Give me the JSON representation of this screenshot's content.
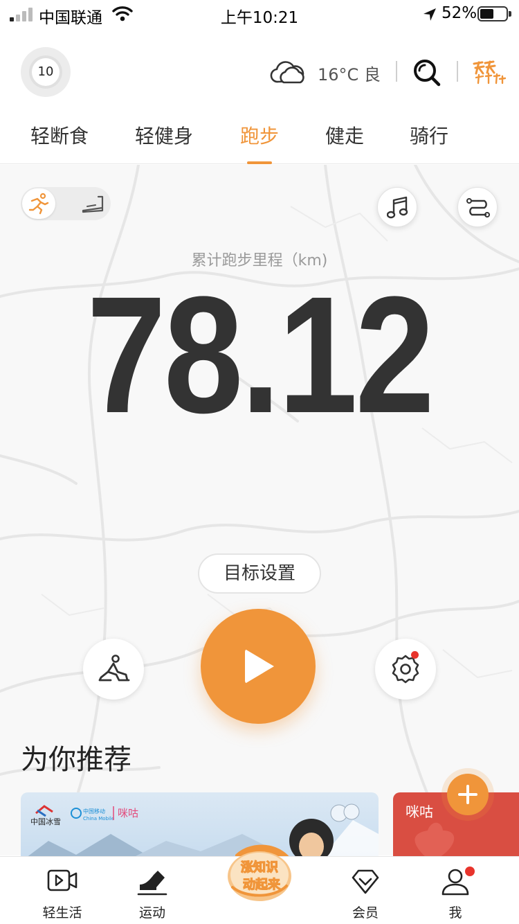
{
  "status_bar": {
    "carrier": "中国联通",
    "time": "上午10:21",
    "battery": "52%",
    "battery_level": 0.52
  },
  "header": {
    "level": "10",
    "weather": "16°C 良",
    "weather_icon": "cloud-icon",
    "brand_logo_text": "天天轻健身"
  },
  "tabs": [
    {
      "label": "轻断食",
      "active": false
    },
    {
      "label": "轻健身",
      "active": false
    },
    {
      "label": "跑步",
      "active": true
    },
    {
      "label": "健走",
      "active": false
    },
    {
      "label": "骑行",
      "active": false
    }
  ],
  "main": {
    "distance_label": "累计跑步里程（km)",
    "distance_value": "78.12",
    "goal_button": "目标设置",
    "recommend_title": "为你推荐"
  },
  "banners": {
    "banner1_brands": "中国冰雪 | 中国移动 China Mobile | 咪咕",
    "banner2_brand": "咪咕"
  },
  "promo": {
    "text_line1": "涨知识",
    "text_line2": "动起来"
  },
  "bottom_nav": [
    {
      "label": "轻生活",
      "icon": "video-icon"
    },
    {
      "label": "运动",
      "icon": "shoe-icon"
    },
    {
      "label": "会员",
      "icon": "diamond-icon"
    },
    {
      "label": "我",
      "icon": "user-icon"
    }
  ],
  "colors": {
    "accent": "#f0953a",
    "text": "#333333",
    "muted": "#9a9a9a",
    "badge_red": "#e8342c"
  }
}
